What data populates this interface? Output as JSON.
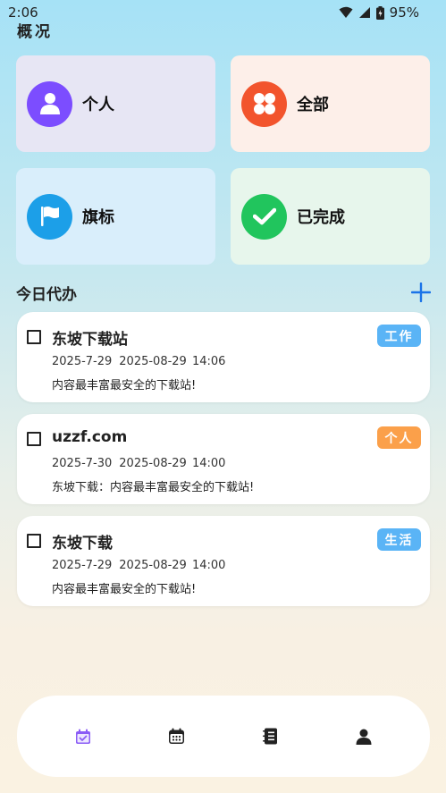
{
  "status_bar": {
    "time": "2:06",
    "battery": "95%"
  },
  "page_title": "概况",
  "categories": [
    {
      "label": "个人",
      "icon": "person-icon",
      "color": "#7c4dff",
      "bg": "#e7e6f4"
    },
    {
      "label": "全部",
      "icon": "grid-icon",
      "color": "#f2542d",
      "bg": "#fdefe9"
    },
    {
      "label": "旗标",
      "icon": "flag-icon",
      "color": "#1c9fe8",
      "bg": "#d9eefb"
    },
    {
      "label": "已完成",
      "icon": "check-icon",
      "color": "#21c55d",
      "bg": "#e7f6ec"
    }
  ],
  "section": {
    "title": "今日代办"
  },
  "todos": [
    {
      "title": "东坡下载站",
      "date": "2025-7-29",
      "datetime": "2025-08-29 14:06",
      "desc": "内容最丰富最安全的下载站!",
      "tag": "工作",
      "tag_color": "#5ab4f6"
    },
    {
      "title": "uzzf.com",
      "date": "2025-7-30",
      "datetime": "2025-08-29 14:00",
      "desc": "东坡下载：内容最丰富最安全的下载站!",
      "tag": "个人",
      "tag_color": "#fba04a"
    },
    {
      "title": "东坡下载",
      "date": "2025-7-29",
      "datetime": "2025-08-29 14:00",
      "desc": "内容最丰富最安全的下载站!",
      "tag": "生活",
      "tag_color": "#5ab4f6"
    }
  ],
  "bottom_nav": [
    {
      "icon": "calendar-check-icon",
      "active": true
    },
    {
      "icon": "calendar-icon",
      "active": false
    },
    {
      "icon": "notebook-icon",
      "active": false
    },
    {
      "icon": "profile-icon",
      "active": false
    }
  ],
  "colors": {
    "accent": "#1a73e8",
    "nav_active": "#8b5cf6"
  }
}
